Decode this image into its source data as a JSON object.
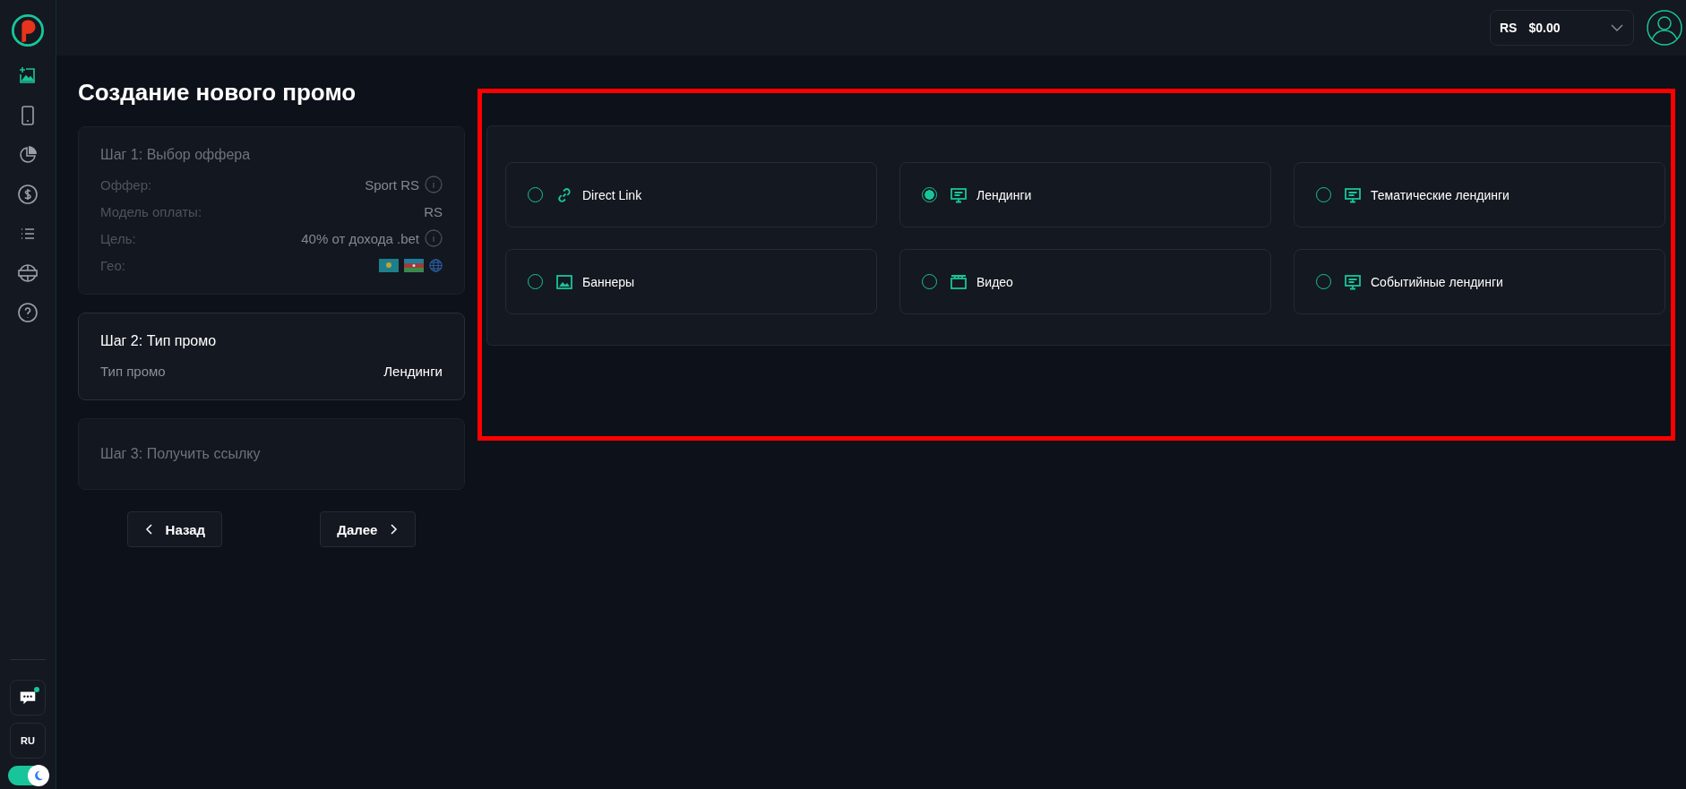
{
  "header": {
    "currency": "RS",
    "balance": "$0.00"
  },
  "sidebar": {
    "items": [
      {
        "kind": "add-image",
        "selected": true
      },
      {
        "kind": "phone",
        "selected": false
      },
      {
        "kind": "pie",
        "selected": false
      },
      {
        "kind": "dollar",
        "selected": false
      },
      {
        "kind": "list",
        "selected": false
      },
      {
        "kind": "news",
        "selected": false
      },
      {
        "kind": "help",
        "selected": false
      }
    ],
    "chat_unread": true,
    "language": "RU",
    "dark_theme": true
  },
  "title": "Создание нового промо",
  "steps": [
    {
      "title": "Шаг 1: Выбор оффера",
      "active": false,
      "rows": [
        {
          "label": "Оффер:",
          "value": "Sport RS",
          "info": true
        },
        {
          "label": "Модель оплаты:",
          "value": "RS",
          "info": false
        },
        {
          "label": "Цель:",
          "value": "40% от дохода .bet",
          "info": true
        },
        {
          "label": "Гео:",
          "kind": "geo"
        }
      ]
    },
    {
      "title": "Шаг 2: Тип промо",
      "active": true,
      "rows": [
        {
          "label": "Тип промо",
          "value": "Лендинги",
          "info": false
        }
      ]
    },
    {
      "title": "Шаг 3: Получить ссылку",
      "active": false
    }
  ],
  "buttons": {
    "back": "Назад",
    "next": "Далее"
  },
  "options": [
    {
      "label": "Direct Link",
      "kind": "link",
      "selected": false
    },
    {
      "label": "Лендинги",
      "kind": "monitor",
      "selected": true
    },
    {
      "label": "Тематические лендинги",
      "kind": "monitor",
      "selected": false
    },
    {
      "label": "Баннеры",
      "kind": "image",
      "selected": false
    },
    {
      "label": "Видео",
      "kind": "video",
      "selected": false
    },
    {
      "label": "Событийные лендинги",
      "kind": "monitor",
      "selected": false
    }
  ]
}
